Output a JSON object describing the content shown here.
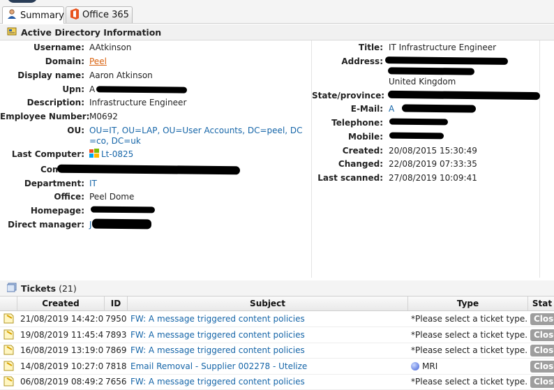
{
  "tabs": [
    {
      "label": "Summary",
      "icon": "user-icon",
      "active": true
    },
    {
      "label": "Office 365",
      "icon": "office-icon",
      "active": false
    }
  ],
  "ad": {
    "title": "Active Directory Information",
    "left": [
      {
        "label": "Username:",
        "value": "AAtkinson"
      },
      {
        "label": "Domain:",
        "value": "Peel"
      },
      {
        "label": "Display name:",
        "value": "Aaron Atkinson"
      },
      {
        "label": "Upn:",
        "value": "A"
      },
      {
        "label": "Description:",
        "value": "Infrastructure Engineer"
      },
      {
        "label": "Employee Number:",
        "value": "M0692"
      },
      {
        "label": "OU:",
        "value": "OU=IT, OU=LAP, OU=User Accounts, DC=peel, DC=co, DC=uk"
      },
      {
        "label": "Last Computer:",
        "value": "Lt-0825"
      },
      {
        "label": "Com",
        "value": ""
      },
      {
        "label": "Department:",
        "value": "IT"
      },
      {
        "label": "Office:",
        "value": "Peel Dome"
      },
      {
        "label": "Homepage:",
        "value": ""
      },
      {
        "label": "Direct manager:",
        "value": "J"
      }
    ],
    "right": [
      {
        "label": "Title:",
        "value": "IT Infrastructure Engineer"
      },
      {
        "label": "Address:",
        "value": "United Kingdom"
      },
      {
        "label": "State/province:",
        "value": ""
      },
      {
        "label": "E-Mail:",
        "value": "A"
      },
      {
        "label": "Telephone:",
        "value": ""
      },
      {
        "label": "Mobile:",
        "value": ""
      },
      {
        "label": "Created:",
        "value": "20/08/2015 15:30:49"
      },
      {
        "label": "Changed:",
        "value": "22/08/2019 07:33:35"
      },
      {
        "label": "Last scanned:",
        "value": "27/08/2019 10:09:41"
      }
    ]
  },
  "tickets": {
    "title": "Tickets",
    "count": "(21)",
    "columns": [
      "Created",
      "ID",
      "Subject",
      "Type",
      "Stat"
    ],
    "rows": [
      {
        "created": "21/08/2019 14:42:03",
        "id": "7950",
        "subject": "FW: A message triggered content policies",
        "type": "*Please select a ticket type...",
        "status": "Close"
      },
      {
        "created": "19/08/2019 11:45:47",
        "id": "7893",
        "subject": "FW: A message triggered content policies",
        "type": "*Please select a ticket type...",
        "status": "Close"
      },
      {
        "created": "16/08/2019 13:19:06",
        "id": "7869",
        "subject": "FW: A message triggered content policies",
        "type": "*Please select a ticket type...",
        "status": "Close"
      },
      {
        "created": "14/08/2019 10:27:00",
        "id": "7818",
        "subject": "Email Removal - Supplier 002278 - Utelize",
        "type": "MRI",
        "status": "Close"
      },
      {
        "created": "06/08/2019 08:49:28",
        "id": "7656",
        "subject": "FW: A message triggered content policies",
        "type": "*Please select a ticket type...",
        "status": "Close"
      }
    ]
  },
  "colors": {
    "link": "#1565a8",
    "domain_link": "#d9620f",
    "close_button": "#9e9e9e"
  }
}
